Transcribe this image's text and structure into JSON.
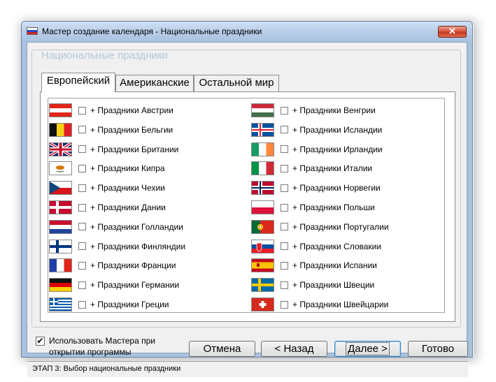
{
  "window": {
    "title": "Мастер создание календаря - Национальные праздники",
    "close_label": "✕"
  },
  "group": {
    "title": "Национальные праздники"
  },
  "tabs": [
    {
      "label": "Европейский",
      "active": true
    },
    {
      "label": "Американские",
      "active": false
    },
    {
      "label": "Остальной мир",
      "active": false
    }
  ],
  "left_items": [
    {
      "label": "+ Праздники Австрии",
      "flag": "austria"
    },
    {
      "label": "+ Праздники Бельгии",
      "flag": "belgium"
    },
    {
      "label": "+ Праздники Британии",
      "flag": "britain"
    },
    {
      "label": "+ Праздники Кипра",
      "flag": "cyprus"
    },
    {
      "label": "+ Праздники Чехии",
      "flag": "czech"
    },
    {
      "label": "+ Праздники Дании",
      "flag": "denmark"
    },
    {
      "label": "+ Праздники Голландии",
      "flag": "netherlands"
    },
    {
      "label": "+ Праздники Финляндии",
      "flag": "finland"
    },
    {
      "label": "+ Праздники Франции",
      "flag": "france"
    },
    {
      "label": "+ Праздники Германии",
      "flag": "germany"
    },
    {
      "label": "+ Праздники Греции",
      "flag": "greece"
    }
  ],
  "right_items": [
    {
      "label": "+ Праздники Венгрии",
      "flag": "hungary"
    },
    {
      "label": "+ Праздники Исландии",
      "flag": "iceland"
    },
    {
      "label": "+ Праздники Ирландии",
      "flag": "ireland"
    },
    {
      "label": "+ Праздники Италии",
      "flag": "italy"
    },
    {
      "label": "+ Праздники Норвегии",
      "flag": "norway"
    },
    {
      "label": "+ Праздники Польши",
      "flag": "poland"
    },
    {
      "label": "+ Праздники Португалии",
      "flag": "portugal"
    },
    {
      "label": "+ Праздники Словакии",
      "flag": "slovakia"
    },
    {
      "label": "+ Праздники Испании",
      "flag": "spain"
    },
    {
      "label": "+ Праздники Швеции",
      "flag": "sweden"
    },
    {
      "label": "+ Праздники Швейцарии",
      "flag": "switzerland"
    }
  ],
  "options": {
    "use_wizard_line1": "Использовать Мастера при",
    "use_wizard_line2": "открытии программы",
    "use_wizard_checked": true
  },
  "buttons": {
    "cancel": "Отмена",
    "back": "< Назад",
    "next": "Далее >",
    "finish": "Готово"
  },
  "status": "ЭТАП 3: Выбор национальные праздники",
  "colors": {
    "window_frame": "#a9c2dd",
    "client_bg": "#f0f0f0",
    "close_red": "#c43a1f"
  }
}
